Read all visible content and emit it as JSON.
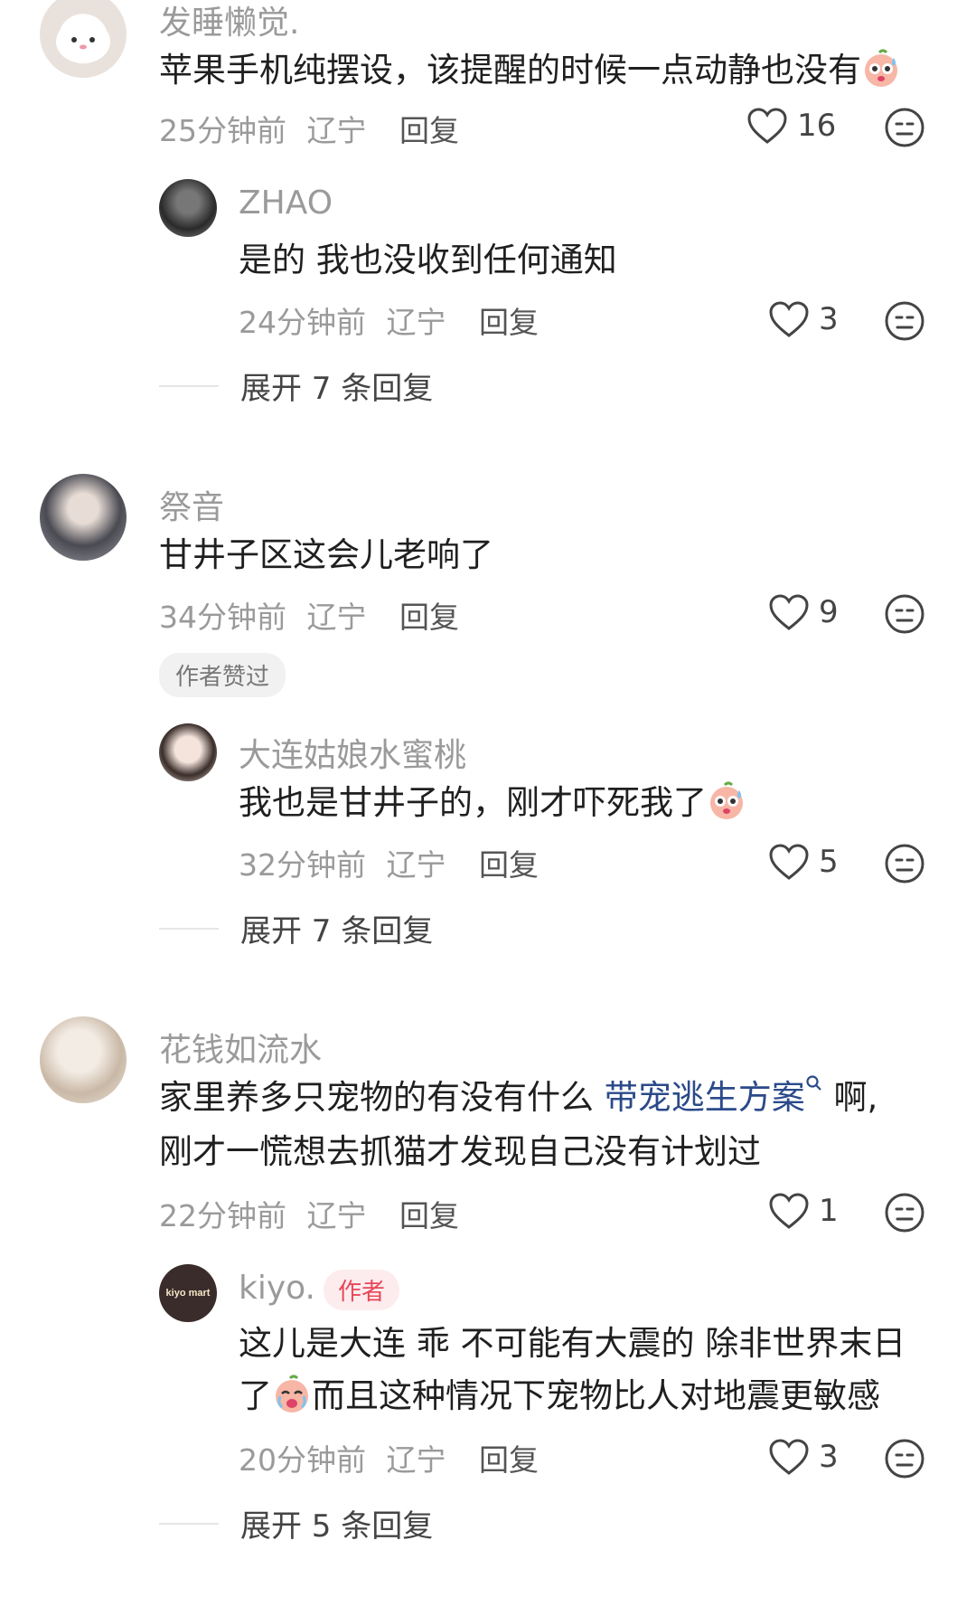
{
  "comments": [
    {
      "name": "发睡懒觉.",
      "text": "苹果手机纯摆设，该提醒的时候一点动静也没有",
      "time": "25分钟前",
      "location": "辽宁",
      "reply_label": "回复",
      "likes": "16",
      "replies": [
        {
          "name": "ZHAO",
          "text": "是的 我也没收到任何通知",
          "time": "24分钟前",
          "location": "辽宁",
          "reply_label": "回复",
          "likes": "3"
        }
      ],
      "expand_label": "展开 7 条回复"
    },
    {
      "name": "祭音",
      "text": "甘井子区这会儿老响了",
      "time": "34分钟前",
      "location": "辽宁",
      "reply_label": "回复",
      "likes": "9",
      "badge": "作者赞过",
      "replies": [
        {
          "name": "大连姑娘水蜜桃",
          "text": "我也是甘井子的，刚才吓死我了",
          "time": "32分钟前",
          "location": "辽宁",
          "reply_label": "回复",
          "likes": "5"
        }
      ],
      "expand_label": "展开 7 条回复"
    },
    {
      "name": "花钱如流水",
      "text_part1": "家里养多只宠物的有没有什么 ",
      "link_text": "带宠逃生方案",
      "text_part2": " 啊,",
      "text_line2": "刚才一慌想去抓猫才发现自己没有计划过",
      "time": "22分钟前",
      "location": "辽宁",
      "reply_label": "回复",
      "likes": "1",
      "replies": [
        {
          "name": "kiyo.",
          "author_tag": "作者",
          "avatar_text": "kiyo mart",
          "text_line1": "这儿是大连 乖 不可能有大震的 除非世界末日",
          "text_line2_a": "了",
          "text_line2_b": "而且这种情况下宠物比人对地震更敏感",
          "time": "20分钟前",
          "location": "辽宁",
          "reply_label": "回复",
          "likes": "3"
        }
      ],
      "expand_label": "展开 5 条回复"
    }
  ],
  "colors": {
    "link": "#2b4a8a",
    "author_tag": "#e8465a",
    "muted": "#9a9a9a"
  }
}
